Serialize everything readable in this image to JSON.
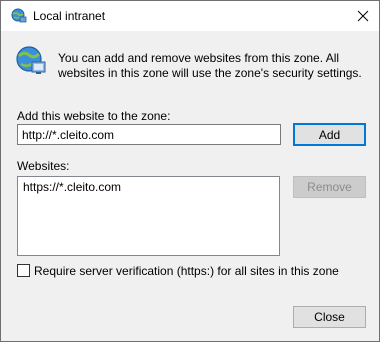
{
  "window": {
    "title": "Local intranet",
    "title_icon": "intranet-globe-icon",
    "close_icon": "close-icon"
  },
  "info": {
    "icon": "intranet-globe-icon",
    "text": "You can add and remove websites from this zone. All websites in this zone will use the zone's security settings."
  },
  "add_section": {
    "label": "Add this website to the zone:",
    "input_value": "http://*.cleito.com",
    "add_button": "Add"
  },
  "websites": {
    "label": "Websites:",
    "items": [
      "https://*.cleito.com"
    ],
    "remove_button": "Remove"
  },
  "verification": {
    "label": "Require server verification (https:) for all sites in this zone",
    "checked": false
  },
  "footer": {
    "close_button": "Close"
  },
  "colors": {
    "accent": "#0078d7",
    "background": "#f0f0f0"
  }
}
